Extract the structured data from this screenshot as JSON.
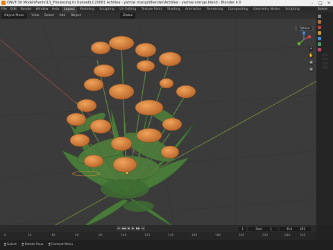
{
  "window": {
    "title": "ONVT-3d Model\\Plants\\13_Processing to Upload\\LC20081 Achillea - yarrow orange\\Blender\\Achillea - yarrow orange.blend - Blender 4.0",
    "minimize": "–",
    "maximize": "□",
    "close": "×"
  },
  "workspaces": [
    "Layout",
    "Modeling",
    "Sculpting",
    "UV Editing",
    "Texture Paint",
    "Shading",
    "Animation",
    "Rendering",
    "Compositing",
    "Geometry Nodes",
    "Scripting"
  ],
  "active_workspace": "Layout",
  "menus": [
    "File",
    "Edit",
    "Render",
    "Window",
    "Help"
  ],
  "scene": "Scene",
  "viewport_header": {
    "mode": "Object Mode",
    "view": "View",
    "select": "Select",
    "add": "Add",
    "object": "Object",
    "orientation": "Global",
    "options": "Options"
  },
  "timeline": {
    "playback": "Playback",
    "keying": "Keying",
    "view": "View",
    "marker": "Marker",
    "current_frame": "1",
    "start_label": "Start",
    "start": "1",
    "end_label": "End",
    "end": "250",
    "ticks": [
      "0",
      "20",
      "40",
      "60",
      "80",
      "100",
      "120",
      "140",
      "160",
      "180",
      "200",
      "220",
      "240",
      "250"
    ]
  },
  "status": {
    "select": "Select",
    "rotate": "Rotate View",
    "context": "Context Menu"
  },
  "colors": {
    "accent": "#4772b3",
    "flower": "#d9823b",
    "foliage": "#4e7a3e",
    "blender_orange": "#e87d0d"
  }
}
